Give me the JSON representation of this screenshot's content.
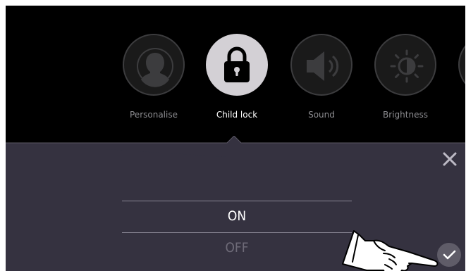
{
  "menu": {
    "items": [
      {
        "label": "Personalise",
        "icon": "person-icon",
        "active": false
      },
      {
        "label": "Child lock",
        "icon": "padlock-icon",
        "active": true
      },
      {
        "label": "Sound",
        "icon": "speaker-icon",
        "active": false
      },
      {
        "label": "Brightness",
        "icon": "sun-icon",
        "active": false
      }
    ]
  },
  "panel": {
    "options": [
      {
        "label": "ON",
        "selected": true
      },
      {
        "label": "OFF",
        "selected": false
      }
    ],
    "close_icon": "close-icon",
    "confirm_icon": "checkmark-icon"
  },
  "overlay": {
    "icon": "pointing-hand-icon"
  },
  "colors": {
    "background": "#000000",
    "panel": "#353240",
    "active_circle": "#d3d0d5",
    "inactive_label": "#8c8c90",
    "divider": "#8a8794"
  }
}
